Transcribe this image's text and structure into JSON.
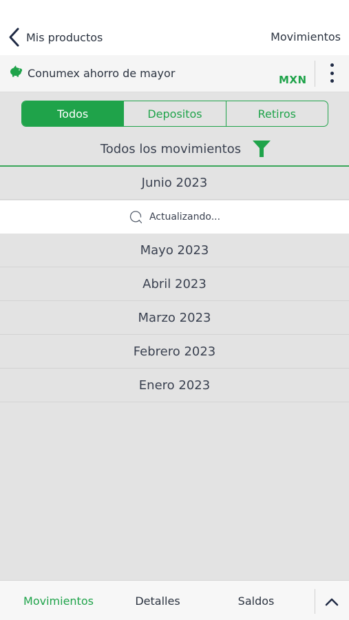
{
  "header": {
    "back_label": "Mis productos",
    "right_title": "Movimientos"
  },
  "product": {
    "name": "Conumex ahorro de mayor",
    "currency": "MXN",
    "icon": "piggy-bank-icon"
  },
  "segments": [
    {
      "label": "Todos",
      "active": true
    },
    {
      "label": "Depositos",
      "active": false
    },
    {
      "label": "Retiros",
      "active": false
    }
  ],
  "filter": {
    "title": "Todos los movimientos",
    "icon": "filter-icon"
  },
  "months": [
    {
      "label": "Junio 2023"
    },
    {
      "label": "Mayo 2023"
    },
    {
      "label": "Abril 2023"
    },
    {
      "label": "Marzo 2023"
    },
    {
      "label": "Febrero 2023"
    },
    {
      "label": "Enero 2023"
    }
  ],
  "loading": {
    "text": "Actualizando..."
  },
  "bottom_nav": {
    "tabs": [
      {
        "label": "Movimientos",
        "active": true
      },
      {
        "label": "Detalles",
        "active": false
      },
      {
        "label": "Saldos",
        "active": false
      }
    ]
  },
  "colors": {
    "accent": "#1fa34a",
    "background": "#e3e3e3",
    "text": "#2b3340"
  }
}
